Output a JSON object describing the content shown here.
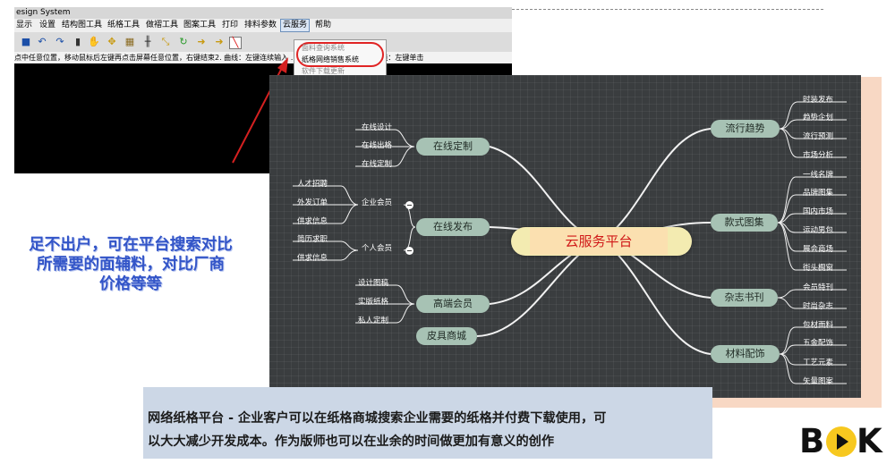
{
  "app": {
    "title": "esign System",
    "menu": [
      "显示",
      "设置",
      "结构图工具",
      "纸格工具",
      "做褶工具",
      "图案工具",
      "打印",
      "排料参数",
      "云服务",
      "帮助"
    ],
    "active_menu": "云服务",
    "dropdown": [
      "面料查询系统",
      "纸格网络销售系统",
      "软件下载更新"
    ],
    "status_bar": "点中任意位置，移动鼠标后左键再点击屏幕任意位置，右键结束2. 曲线：左键连续输入 …… 后右键结束3. 水平垂直线：左键单击"
  },
  "left_caption": {
    "line1": "足不出户，可在平台搜索对比",
    "line2": "所需要的面辅料，对比厂商",
    "line3": "价格等等"
  },
  "mindmap": {
    "center": "云服务平台",
    "branches": {
      "online_custom": {
        "label": "在线定制",
        "leaves": [
          "在线设计",
          "在线出格",
          "在线定制"
        ]
      },
      "online_publish": {
        "label": "在线发布",
        "enterprise": {
          "label": "企业会员",
          "leaves": [
            "人才招聘",
            "外发订单",
            "供求信息"
          ]
        },
        "personal": {
          "label": "个人会员",
          "leaves": [
            "简历求职",
            "供求信息"
          ]
        }
      },
      "premium": {
        "label": "高端会员",
        "leaves": [
          "设计图稿",
          "实版纸格",
          "私人定制"
        ]
      },
      "leather": {
        "label": "皮具商城"
      },
      "trends": {
        "label": "流行趋势",
        "leaves": [
          "时装发布",
          "趋势企划",
          "流行预测",
          "市场分析"
        ]
      },
      "styles": {
        "label": "款式图集",
        "leaves": [
          "一线名牌",
          "品牌图集",
          "国内市场",
          "运动男包",
          "展会商场",
          "街头橱窗"
        ]
      },
      "magazines": {
        "label": "杂志书刊",
        "leaves": [
          "会员特刊",
          "时尚杂志"
        ]
      },
      "materials": {
        "label": "材料配饰",
        "leaves": [
          "包材面料",
          "五金配饰",
          "工艺元素",
          "矢量图案"
        ]
      }
    }
  },
  "description": {
    "line1": "网络纸格平台 - 企业客户可以在纸格商城搜索企业需要的纸格并付费下载使用，可",
    "line2": "以大大减少开发成本。作为版师也可以在业余的时间做更加有意义的创作"
  },
  "logo": {
    "left": "B",
    "right": "K"
  }
}
